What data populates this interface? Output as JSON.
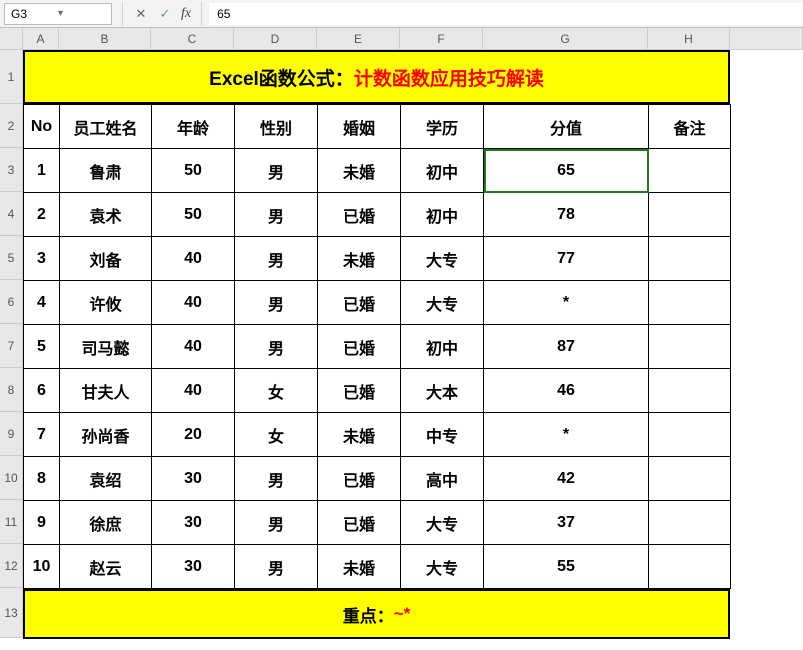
{
  "formula_bar": {
    "cell_ref": "G3",
    "fx_label": "fx",
    "value": "65"
  },
  "col_headers": [
    "A",
    "B",
    "C",
    "D",
    "E",
    "F",
    "G",
    "H"
  ],
  "row_headers": [
    "1",
    "2",
    "3",
    "4",
    "5",
    "6",
    "7",
    "8",
    "9",
    "10",
    "11",
    "12",
    "13"
  ],
  "title": {
    "black": "Excel函数公式：",
    "red": "计数函数应用技巧解读"
  },
  "footer": {
    "black": "重点：",
    "red": "~*"
  },
  "table": {
    "headers": [
      "No",
      "员工姓名",
      "年龄",
      "性别",
      "婚姻",
      "学历",
      "分值",
      "备注"
    ],
    "rows": [
      {
        "no": "1",
        "name": "鲁肃",
        "age": "50",
        "gender": "男",
        "marital": "未婚",
        "edu": "初中",
        "score": "65",
        "note": ""
      },
      {
        "no": "2",
        "name": "袁术",
        "age": "50",
        "gender": "男",
        "marital": "已婚",
        "edu": "初中",
        "score": "78",
        "note": ""
      },
      {
        "no": "3",
        "name": "刘备",
        "age": "40",
        "gender": "男",
        "marital": "未婚",
        "edu": "大专",
        "score": "77",
        "note": ""
      },
      {
        "no": "4",
        "name": "许攸",
        "age": "40",
        "gender": "男",
        "marital": "已婚",
        "edu": "大专",
        "score": "*",
        "note": ""
      },
      {
        "no": "5",
        "name": "司马懿",
        "age": "40",
        "gender": "男",
        "marital": "已婚",
        "edu": "初中",
        "score": "87",
        "note": ""
      },
      {
        "no": "6",
        "name": "甘夫人",
        "age": "40",
        "gender": "女",
        "marital": "已婚",
        "edu": "大本",
        "score": "46",
        "note": ""
      },
      {
        "no": "7",
        "name": "孙尚香",
        "age": "20",
        "gender": "女",
        "marital": "未婚",
        "edu": "中专",
        "score": "*",
        "note": ""
      },
      {
        "no": "8",
        "name": "袁绍",
        "age": "30",
        "gender": "男",
        "marital": "已婚",
        "edu": "高中",
        "score": "42",
        "note": ""
      },
      {
        "no": "9",
        "name": "徐庶",
        "age": "30",
        "gender": "男",
        "marital": "已婚",
        "edu": "大专",
        "score": "37",
        "note": ""
      },
      {
        "no": "10",
        "name": "赵云",
        "age": "30",
        "gender": "男",
        "marital": "未婚",
        "edu": "大专",
        "score": "55",
        "note": ""
      }
    ]
  },
  "selected_cell": "G3"
}
